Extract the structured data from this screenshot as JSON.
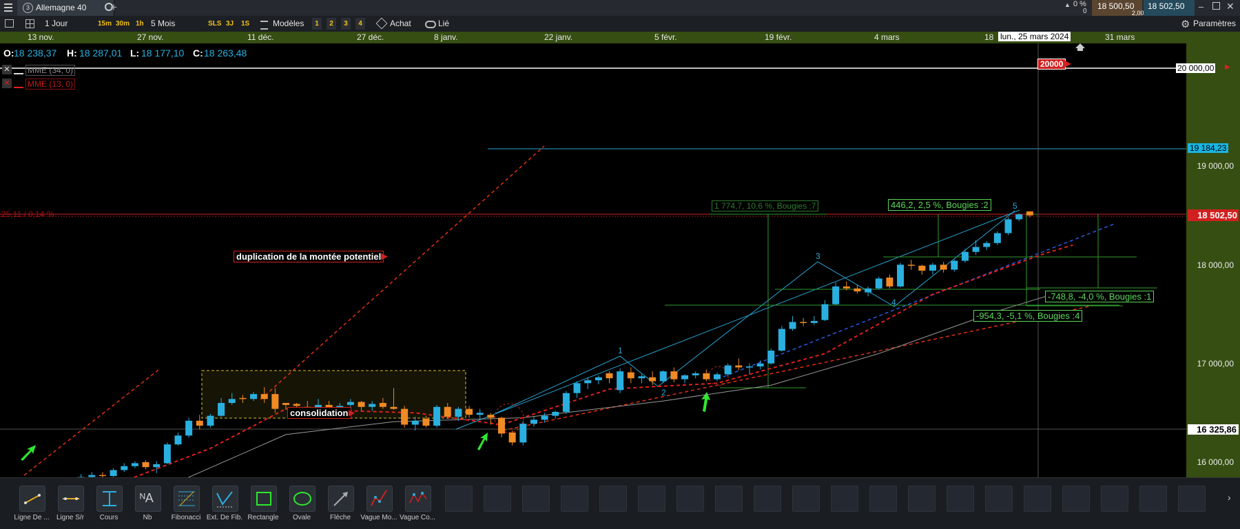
{
  "tabbar": {
    "instrument_tab": "Allemagne 40",
    "change_pct": "0 %",
    "change_abs": "0",
    "bid": "18 500,50",
    "ask": "18 502,50",
    "spread": "2,00"
  },
  "toolbar": {
    "period": "1 Jour",
    "timeframes": [
      "15m",
      "30m",
      "1h"
    ],
    "range": "5 Mois",
    "quick": [
      "SLS",
      "3J",
      "1S"
    ],
    "templates": "Modèles",
    "numbers": [
      "1",
      "2",
      "3",
      "4"
    ],
    "buy": "Achat",
    "linked": "Lié",
    "settings": "Paramètres"
  },
  "dates": [
    "13 nov.",
    "27 nov.",
    "11 déc.",
    "27 déc.",
    "8 janv.",
    "22 janv.",
    "5 févr.",
    "19 févr.",
    "4 mars",
    "18",
    "31 mars"
  ],
  "cursor_date": "lun., 25 mars 2024",
  "ohlc": {
    "o_label": "O:",
    "o": "18 238,37",
    "h_label": "H:",
    "h": "18 287,01",
    "l_label": "L:",
    "l": "18 177,10",
    "c_label": "C:",
    "c": "18 263,48"
  },
  "indicators": [
    {
      "label": "MME (34, 0)",
      "color": "#b0b0b0"
    },
    {
      "label": "MME (13, 0)",
      "color": "#d0201f"
    }
  ],
  "price_axis": [
    "19 000,00",
    "18 000,00",
    "17 000,00",
    "16 000,00"
  ],
  "price_tags": {
    "target": "20 000,00",
    "cyan_line": "19 184,23",
    "current": "18 502,50",
    "support": "16 325,86"
  },
  "current_change": "25,11 / 0,14 %",
  "annotations": {
    "target_flag": "20000",
    "duplication": "duplication de la montée potentiel",
    "consolidation": "consolidation",
    "m1": "1 774,7, 10,6 %, Bougies :7",
    "m2": "446,2, 2,5 %, Bougies :2",
    "m3": "-748,8, -4,0 %, Bougies :1",
    "m4": "-954,3, -5,1 %, Bougies :4",
    "wave": [
      "1",
      "2",
      "3",
      "4",
      "5"
    ]
  },
  "tools": [
    "Ligne De ...",
    "Ligne S/r",
    "Cours",
    "Nb",
    "Fibonacci",
    "Ext. De Fib.",
    "Rectangle",
    "Ovale",
    "Flèche",
    "Vague Mo...",
    "Vague Co..."
  ],
  "colors": {
    "bull": "#2ab0e0",
    "bear": "#f08a24",
    "ema34": "#9a9a9a",
    "ema13": "#e0201c",
    "accent_green": "#364e12"
  },
  "chart_data": {
    "type": "candlestick",
    "ylim": [
      15850,
      20150
    ],
    "candles": [
      [
        15750,
        15820,
        15700,
        15800
      ],
      [
        15790,
        15880,
        15780,
        15850
      ],
      [
        15850,
        15900,
        15820,
        15870
      ],
      [
        15870,
        15900,
        15830,
        15860
      ],
      [
        15860,
        15940,
        15850,
        15920
      ],
      [
        15920,
        15990,
        15900,
        15960
      ],
      [
        15960,
        16010,
        15940,
        15990
      ],
      [
        16000,
        16020,
        15930,
        15950
      ],
      [
        15950,
        16010,
        15890,
        15980
      ],
      [
        15990,
        16200,
        15980,
        16180
      ],
      [
        16180,
        16300,
        16170,
        16270
      ],
      [
        16270,
        16450,
        16250,
        16420
      ],
      [
        16420,
        16480,
        16330,
        16370
      ],
      [
        16370,
        16490,
        16350,
        16470
      ],
      [
        16470,
        16650,
        16460,
        16600
      ],
      [
        16600,
        16700,
        16580,
        16640
      ],
      [
        16650,
        16680,
        16600,
        16640
      ],
      [
        16640,
        16710,
        16620,
        16690
      ],
      [
        16690,
        16760,
        16600,
        16640
      ],
      [
        16690,
        16750,
        16500,
        16540
      ],
      [
        16600,
        16600,
        16530,
        16580
      ],
      [
        16590,
        16600,
        16520,
        16570
      ],
      [
        16560,
        16620,
        16470,
        16500
      ],
      [
        16500,
        16640,
        16480,
        16580
      ],
      [
        16580,
        16620,
        16500,
        16540
      ],
      [
        16540,
        16600,
        16500,
        16570
      ],
      [
        16580,
        16640,
        16560,
        16610
      ],
      [
        16610,
        16620,
        16520,
        16560
      ],
      [
        16560,
        16620,
        16520,
        16590
      ],
      [
        16600,
        16650,
        16540,
        16560
      ],
      [
        16560,
        16750,
        16530,
        16540
      ],
      [
        16540,
        16570,
        16350,
        16380
      ],
      [
        16380,
        16460,
        16320,
        16420
      ],
      [
        16440,
        16470,
        16350,
        16370
      ],
      [
        16370,
        16580,
        16350,
        16560
      ],
      [
        16560,
        16600,
        16440,
        16460
      ],
      [
        16460,
        16560,
        16420,
        16540
      ],
      [
        16540,
        16570,
        16450,
        16480
      ],
      [
        16480,
        16540,
        16440,
        16500
      ],
      [
        16480,
        16500,
        16380,
        16450
      ],
      [
        16450,
        16460,
        16250,
        16290
      ],
      [
        16300,
        16320,
        16170,
        16200
      ],
      [
        16200,
        16420,
        16170,
        16390
      ],
      [
        16390,
        16460,
        16360,
        16430
      ],
      [
        16430,
        16500,
        16400,
        16470
      ],
      [
        16470,
        16520,
        16440,
        16510
      ],
      [
        16510,
        16720,
        16490,
        16700
      ],
      [
        16700,
        16820,
        16650,
        16800
      ],
      [
        16800,
        16860,
        16740,
        16830
      ],
      [
        16830,
        16880,
        16790,
        16860
      ],
      [
        16900,
        16920,
        16800,
        16850
      ],
      [
        16730,
        16950,
        16700,
        16920
      ],
      [
        16910,
        16960,
        16800,
        16850
      ],
      [
        16850,
        16890,
        16800,
        16870
      ],
      [
        16860,
        16920,
        16780,
        16820
      ],
      [
        16820,
        16930,
        16800,
        16920
      ],
      [
        16920,
        16960,
        16810,
        16840
      ],
      [
        16840,
        16890,
        16800,
        16880
      ],
      [
        16880,
        16920,
        16850,
        16900
      ],
      [
        16900,
        16940,
        16820,
        16840
      ],
      [
        16840,
        16910,
        16820,
        16890
      ],
      [
        16890,
        17000,
        16870,
        16980
      ],
      [
        16980,
        17050,
        16930,
        16960
      ],
      [
        16960,
        17000,
        16890,
        16970
      ],
      [
        16970,
        17030,
        16940,
        17000
      ],
      [
        17000,
        17150,
        16990,
        17130
      ],
      [
        17130,
        17380,
        17120,
        17350
      ],
      [
        17350,
        17480,
        17330,
        17420
      ],
      [
        17420,
        17460,
        17380,
        17410
      ],
      [
        17410,
        17480,
        17390,
        17430
      ],
      [
        17440,
        17640,
        17430,
        17600
      ],
      [
        17600,
        17820,
        17590,
        17780
      ],
      [
        17780,
        17830,
        17740,
        17760
      ],
      [
        17760,
        17800,
        17710,
        17730
      ],
      [
        17720,
        17780,
        17680,
        17760
      ],
      [
        17760,
        17880,
        17750,
        17860
      ],
      [
        17870,
        17900,
        17760,
        17780
      ],
      [
        17780,
        18020,
        17770,
        18000
      ],
      [
        18000,
        18050,
        17950,
        17990
      ],
      [
        17990,
        18000,
        17900,
        17940
      ],
      [
        17940,
        18020,
        17900,
        18000
      ],
      [
        18000,
        18030,
        17920,
        17950
      ],
      [
        17950,
        18050,
        17930,
        18040
      ],
      [
        18040,
        18160,
        18020,
        18130
      ],
      [
        18130,
        18250,
        18100,
        18180
      ],
      [
        18180,
        18240,
        18150,
        18220
      ],
      [
        18220,
        18340,
        18200,
        18320
      ],
      [
        18320,
        18480,
        18300,
        18460
      ],
      [
        18460,
        18520,
        18440,
        18510
      ],
      [
        18540,
        18540,
        18480,
        18500
      ]
    ],
    "ema13": [
      [
        0,
        15600
      ],
      [
        13,
        16140
      ],
      [
        20,
        16540
      ],
      [
        32,
        16500
      ],
      [
        40,
        16380
      ],
      [
        50,
        16740
      ],
      [
        60,
        16800
      ],
      [
        70,
        17100
      ],
      [
        80,
        17700
      ],
      [
        90,
        18100
      ],
      [
        93,
        18200
      ]
    ],
    "ema34": [
      [
        0,
        15300
      ],
      [
        10,
        15800
      ],
      [
        20,
        16280
      ],
      [
        30,
        16410
      ],
      [
        42,
        16450
      ],
      [
        55,
        16620
      ],
      [
        65,
        16780
      ],
      [
        75,
        17100
      ],
      [
        86,
        17530
      ],
      [
        92,
        17730
      ]
    ]
  }
}
